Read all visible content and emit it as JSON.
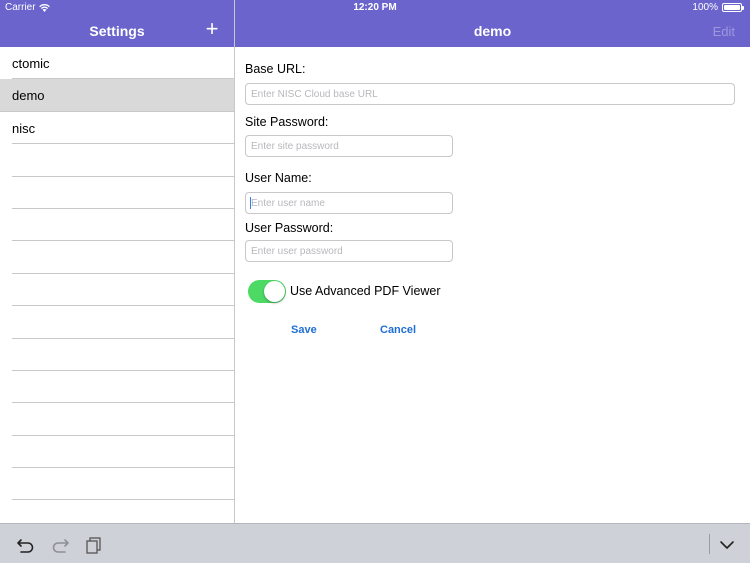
{
  "status_bar": {
    "carrier": "Carrier",
    "time": "12:20 PM",
    "battery": "100%"
  },
  "sidebar": {
    "title": "Settings",
    "add_label": "+",
    "items": [
      {
        "label": "ctomic",
        "selected": false
      },
      {
        "label": "demo",
        "selected": true
      },
      {
        "label": "nisc",
        "selected": false
      },
      {
        "label": "",
        "selected": false
      },
      {
        "label": "",
        "selected": false
      },
      {
        "label": "",
        "selected": false
      },
      {
        "label": "",
        "selected": false
      },
      {
        "label": "",
        "selected": false
      },
      {
        "label": "",
        "selected": false
      },
      {
        "label": "",
        "selected": false
      },
      {
        "label": "",
        "selected": false
      },
      {
        "label": "",
        "selected": false
      },
      {
        "label": "",
        "selected": false
      },
      {
        "label": "",
        "selected": false
      }
    ]
  },
  "detail": {
    "title": "demo",
    "edit_label": "Edit"
  },
  "form": {
    "base_url": {
      "label": "Base URL:",
      "placeholder": "Enter NISC Cloud base URL",
      "value": ""
    },
    "site_password": {
      "label": "Site Password:",
      "placeholder": "Enter site password",
      "value": ""
    },
    "user_name": {
      "label": "User Name:",
      "placeholder": "Enter user name",
      "value": ""
    },
    "user_password": {
      "label": "User Password:",
      "placeholder": "Enter user password",
      "value": ""
    },
    "pdf_viewer": {
      "label": "Use Advanced PDF Viewer",
      "enabled": true
    },
    "save_label": "Save",
    "cancel_label": "Cancel"
  },
  "colors": {
    "header": "#6a64cc",
    "toggle_on": "#4cd964",
    "link": "#1f6fd6",
    "selected_row": "#d9d9d9"
  },
  "toolbar": {
    "icons": [
      "undo-icon",
      "redo-icon",
      "paste-icon",
      "keyboard-dismiss-icon"
    ]
  }
}
